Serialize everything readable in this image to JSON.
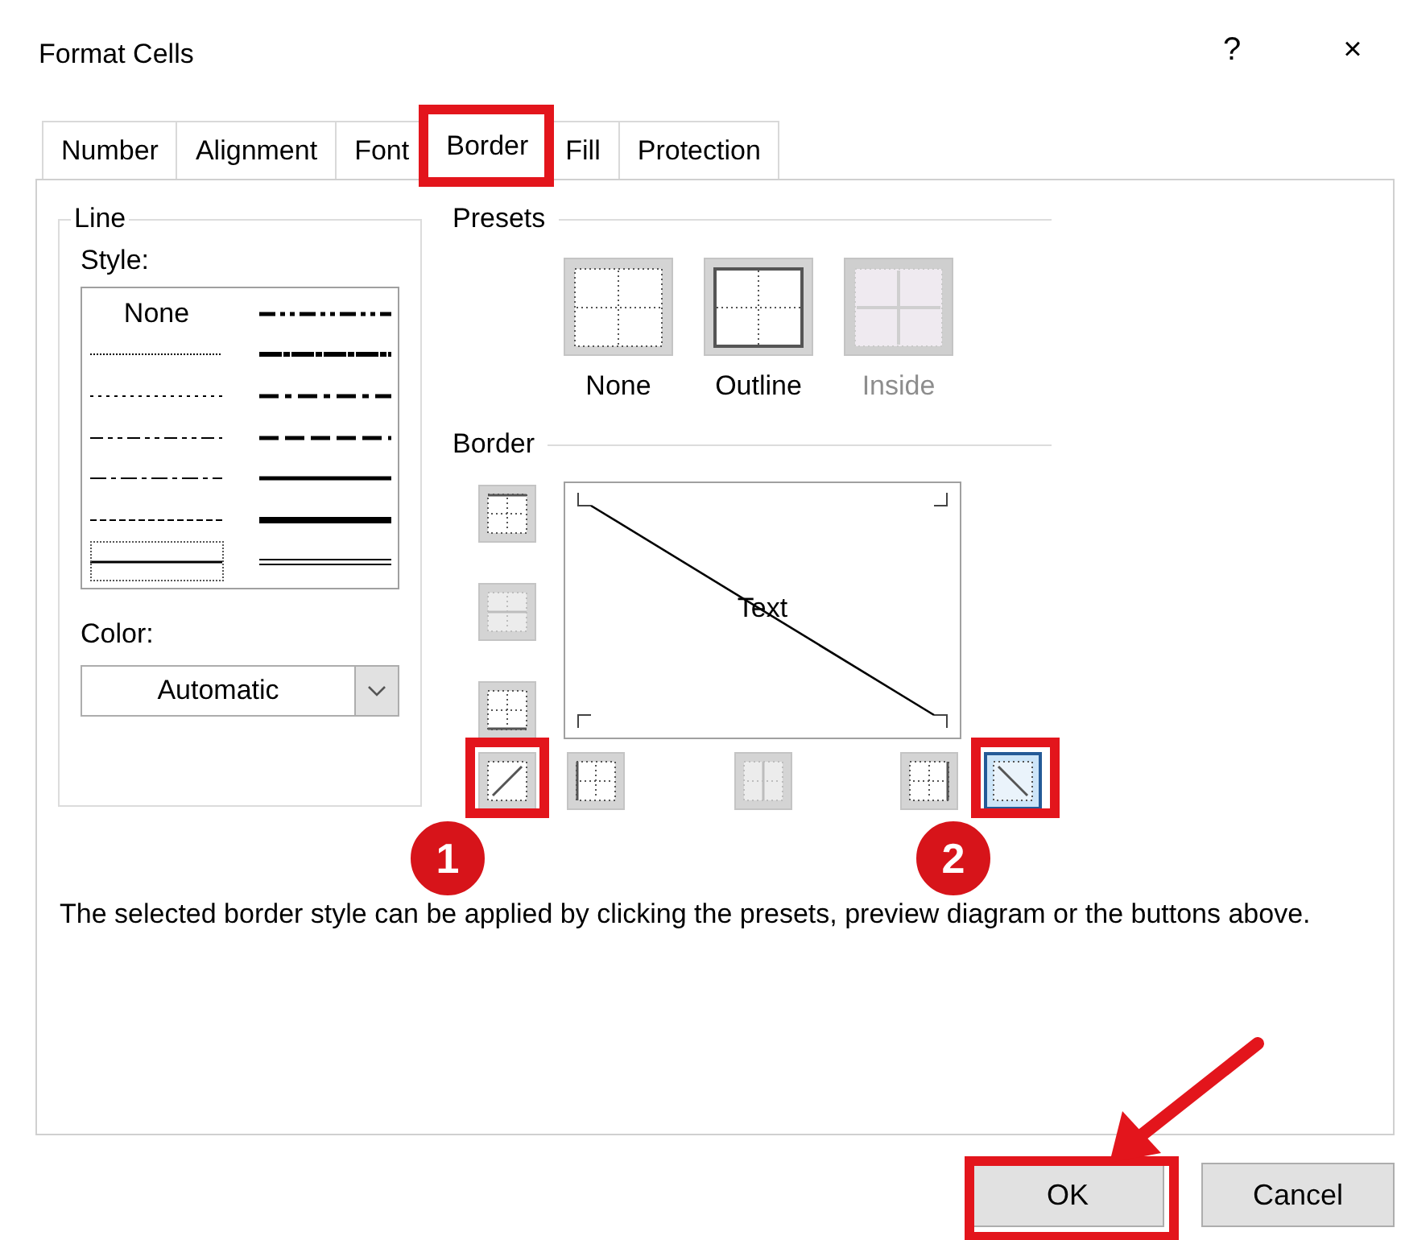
{
  "window": {
    "title": "Format Cells",
    "help": "?",
    "close": "×"
  },
  "tabs": [
    {
      "label": "Number",
      "selected": false
    },
    {
      "label": "Alignment",
      "selected": false
    },
    {
      "label": "Font",
      "selected": false
    },
    {
      "label": "Border",
      "selected": true,
      "highlighted": true
    },
    {
      "label": "Fill",
      "selected": false
    },
    {
      "label": "Protection",
      "selected": false
    }
  ],
  "line": {
    "title": "Line",
    "style_label": "Style:",
    "styles": [
      {
        "kind": "none",
        "label": "None",
        "selected": false
      },
      {
        "kind": "hair",
        "selected": false
      },
      {
        "kind": "dotted",
        "selected": false
      },
      {
        "kind": "dash_dot_dot",
        "selected": false
      },
      {
        "kind": "dash_dot",
        "selected": false
      },
      {
        "kind": "dashed",
        "selected": false
      },
      {
        "kind": "thin",
        "selected": true
      },
      {
        "kind": "medium_dash_dot_dot",
        "selected": false
      },
      {
        "kind": "slant_dash_dot",
        "selected": false
      },
      {
        "kind": "medium_dash_dot",
        "selected": false
      },
      {
        "kind": "medium_dashed",
        "selected": false
      },
      {
        "kind": "medium",
        "selected": false
      },
      {
        "kind": "thick",
        "selected": false
      },
      {
        "kind": "double",
        "selected": false
      }
    ],
    "color_label": "Color:",
    "color_value": "Automatic"
  },
  "presets": {
    "title": "Presets",
    "items": [
      {
        "kind": "none",
        "label": "None",
        "disabled": false
      },
      {
        "kind": "outline",
        "label": "Outline",
        "disabled": false
      },
      {
        "kind": "inside",
        "label": "Inside",
        "disabled": true
      }
    ]
  },
  "border": {
    "title": "Border",
    "preview_text": "Text",
    "buttons": [
      {
        "kind": "top",
        "selected": false,
        "disabled": false
      },
      {
        "kind": "middle",
        "selected": false,
        "disabled": true
      },
      {
        "kind": "bottom",
        "selected": false,
        "disabled": false
      },
      {
        "kind": "diag_up",
        "selected": false,
        "disabled": false,
        "highlighted": true,
        "badge": "1"
      },
      {
        "kind": "left",
        "selected": false,
        "disabled": false
      },
      {
        "kind": "center",
        "selected": false,
        "disabled": true
      },
      {
        "kind": "right",
        "selected": false,
        "disabled": false
      },
      {
        "kind": "diag_down",
        "selected": true,
        "disabled": false,
        "highlighted": true,
        "badge": "2"
      }
    ]
  },
  "description": "The selected border style can be applied by clicking the presets, preview diagram or the buttons above.",
  "buttons": [
    {
      "label": "OK",
      "highlighted": true,
      "arrow": true
    },
    {
      "label": "Cancel"
    }
  ]
}
